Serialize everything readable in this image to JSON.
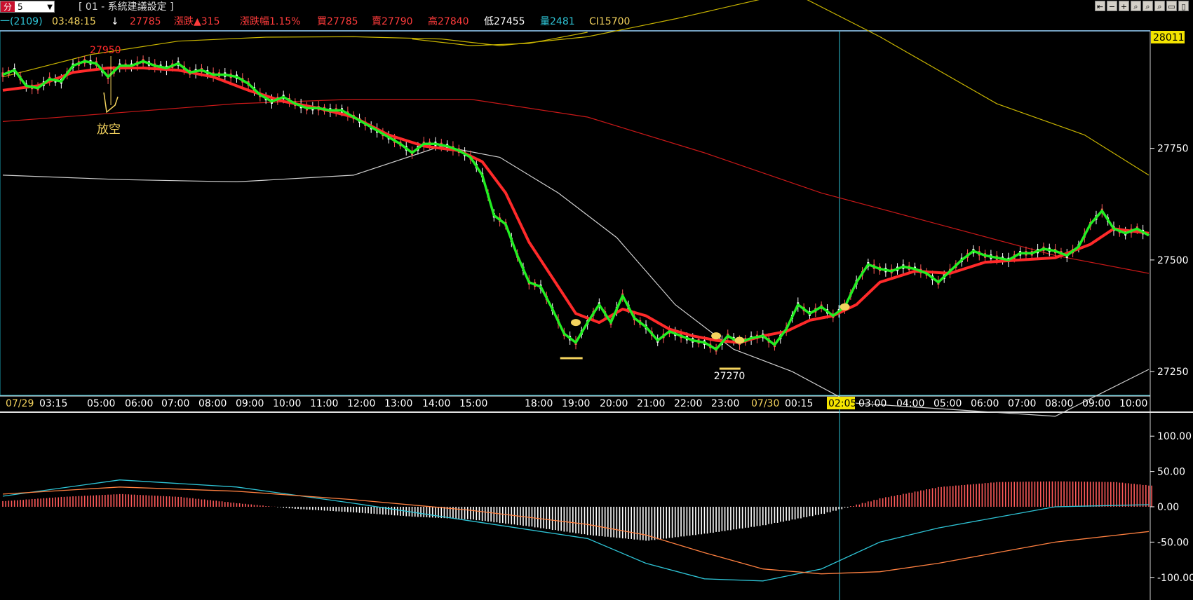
{
  "toolbar": {
    "period_prefix": "分",
    "period_value": "5",
    "title": "[ 01 - 系統建議設定 ]",
    "window_buttons": [
      "⇤",
      "−",
      "+",
      "⌕",
      "⌕",
      "⌕",
      "▭",
      "▯"
    ]
  },
  "quote": {
    "code": "一(2109)",
    "time": "03:48:15",
    "arrow": "↓",
    "price": "27785",
    "change": "漲跌▲315",
    "change_pct": "漲跌幅1.15%",
    "bid": "買27785",
    "ask": "賣27790",
    "high": "高27840",
    "low": "低27455",
    "volume": "量2481",
    "ci": "CI15700"
  },
  "colors": {
    "cyan": "#2ec4d6",
    "yellow": "#f4d35e",
    "red": "#ff2a2a",
    "green": "#22ee22",
    "white": "#ffffff",
    "grey": "#d0d0d0",
    "pink": "#ff5a5a",
    "orange": "#ff8040",
    "olive": "#c8b400"
  },
  "chart_data": [
    {
      "type": "line",
      "panel": "price",
      "y_axis_ticks": [
        27750,
        27500,
        27250
      ],
      "y_range": [
        27200,
        28010
      ],
      "top_price_label": "28011",
      "x_tick_labels": [
        "07/29 03:15",
        "05:00",
        "06:00",
        "07:00",
        "08:00",
        "09:00",
        "10:00",
        "11:00",
        "12:00",
        "13:00",
        "14:00",
        "15:00",
        "18:00",
        "19:00",
        "20:00",
        "21:00",
        "22:00",
        "23:00",
        "07/30 00:15",
        "02:05",
        "03:00",
        "04:00",
        "05:00",
        "06:00",
        "07:00",
        "08:00",
        "09:00",
        "10:00"
      ],
      "cursor_label": "02:05",
      "annotations": {
        "high_label": "27950",
        "low_label": "27270",
        "signal_text": "放空"
      },
      "series": {
        "green_fast": [
          [
            0,
            27915
          ],
          [
            2,
            27925
          ],
          [
            4,
            27890
          ],
          [
            6,
            27885
          ],
          [
            8,
            27905
          ],
          [
            10,
            27900
          ],
          [
            12,
            27935
          ],
          [
            14,
            27945
          ],
          [
            16,
            27940
          ],
          [
            18,
            27910
          ],
          [
            20,
            27935
          ],
          [
            22,
            27935
          ],
          [
            24,
            27945
          ],
          [
            26,
            27935
          ],
          [
            28,
            27930
          ],
          [
            30,
            27940
          ],
          [
            32,
            27920
          ],
          [
            34,
            27925
          ],
          [
            36,
            27915
          ],
          [
            38,
            27915
          ],
          [
            40,
            27910
          ],
          [
            42,
            27895
          ],
          [
            44,
            27870
          ],
          [
            46,
            27855
          ],
          [
            48,
            27865
          ],
          [
            50,
            27850
          ],
          [
            52,
            27840
          ],
          [
            54,
            27840
          ],
          [
            56,
            27835
          ],
          [
            58,
            27835
          ],
          [
            60,
            27820
          ],
          [
            62,
            27805
          ],
          [
            64,
            27790
          ],
          [
            66,
            27775
          ],
          [
            68,
            27760
          ],
          [
            70,
            27740
          ],
          [
            72,
            27760
          ],
          [
            74,
            27760
          ],
          [
            76,
            27755
          ],
          [
            78,
            27745
          ],
          [
            80,
            27730
          ],
          [
            82,
            27690
          ],
          [
            84,
            27600
          ],
          [
            86,
            27580
          ],
          [
            88,
            27510
          ],
          [
            90,
            27450
          ],
          [
            92,
            27440
          ],
          [
            94,
            27390
          ],
          [
            96,
            27335
          ],
          [
            98,
            27315
          ],
          [
            100,
            27360
          ],
          [
            102,
            27400
          ],
          [
            104,
            27360
          ],
          [
            106,
            27420
          ],
          [
            108,
            27370
          ],
          [
            110,
            27350
          ],
          [
            112,
            27320
          ],
          [
            114,
            27340
          ],
          [
            116,
            27330
          ],
          [
            118,
            27320
          ],
          [
            120,
            27315
          ],
          [
            122,
            27300
          ],
          [
            124,
            27330
          ],
          [
            126,
            27315
          ],
          [
            128,
            27325
          ],
          [
            130,
            27330
          ],
          [
            132,
            27310
          ],
          [
            134,
            27345
          ],
          [
            136,
            27400
          ],
          [
            138,
            27380
          ],
          [
            140,
            27395
          ],
          [
            142,
            27375
          ],
          [
            144,
            27395
          ],
          [
            146,
            27450
          ],
          [
            148,
            27490
          ],
          [
            150,
            27480
          ],
          [
            152,
            27475
          ],
          [
            154,
            27485
          ],
          [
            156,
            27480
          ],
          [
            158,
            27470
          ],
          [
            160,
            27450
          ],
          [
            162,
            27475
          ],
          [
            164,
            27500
          ],
          [
            166,
            27520
          ],
          [
            168,
            27510
          ],
          [
            170,
            27505
          ],
          [
            172,
            27500
          ],
          [
            174,
            27515
          ],
          [
            176,
            27515
          ],
          [
            178,
            27525
          ],
          [
            180,
            27520
          ],
          [
            182,
            27510
          ],
          [
            184,
            27530
          ],
          [
            186,
            27580
          ],
          [
            188,
            27610
          ],
          [
            190,
            27570
          ],
          [
            192,
            27560
          ],
          [
            194,
            27570
          ],
          [
            196,
            27555
          ]
        ],
        "red_ma": [
          [
            0,
            27880
          ],
          [
            6,
            27890
          ],
          [
            12,
            27920
          ],
          [
            18,
            27930
          ],
          [
            24,
            27930
          ],
          [
            30,
            27925
          ],
          [
            36,
            27910
          ],
          [
            42,
            27880
          ],
          [
            48,
            27855
          ],
          [
            54,
            27840
          ],
          [
            60,
            27820
          ],
          [
            66,
            27780
          ],
          [
            72,
            27755
          ],
          [
            78,
            27745
          ],
          [
            82,
            27720
          ],
          [
            86,
            27650
          ],
          [
            90,
            27540
          ],
          [
            94,
            27460
          ],
          [
            98,
            27380
          ],
          [
            102,
            27360
          ],
          [
            106,
            27390
          ],
          [
            110,
            27375
          ],
          [
            114,
            27345
          ],
          [
            118,
            27330
          ],
          [
            122,
            27320
          ],
          [
            126,
            27315
          ],
          [
            130,
            27330
          ],
          [
            134,
            27340
          ],
          [
            138,
            27365
          ],
          [
            142,
            27375
          ],
          [
            146,
            27400
          ],
          [
            150,
            27450
          ],
          [
            156,
            27475
          ],
          [
            162,
            27470
          ],
          [
            168,
            27495
          ],
          [
            174,
            27500
          ],
          [
            180,
            27505
          ],
          [
            186,
            27535
          ],
          [
            190,
            27570
          ],
          [
            196,
            27560
          ]
        ],
        "red_long": [
          [
            0,
            27810
          ],
          [
            20,
            27830
          ],
          [
            40,
            27850
          ],
          [
            60,
            27860
          ],
          [
            80,
            27860
          ],
          [
            100,
            27820
          ],
          [
            120,
            27740
          ],
          [
            140,
            27650
          ],
          [
            160,
            27580
          ],
          [
            180,
            27510
          ],
          [
            196,
            27470
          ]
        ],
        "white_ma": [
          [
            0,
            27690
          ],
          [
            20,
            27680
          ],
          [
            40,
            27675
          ],
          [
            60,
            27690
          ],
          [
            75,
            27755
          ],
          [
            85,
            27730
          ],
          [
            95,
            27650
          ],
          [
            105,
            27550
          ],
          [
            115,
            27400
          ],
          [
            125,
            27300
          ],
          [
            135,
            27250
          ],
          [
            145,
            27180
          ],
          [
            180,
            27150
          ],
          [
            196,
            27255
          ]
        ],
        "yellow_band_upper": [
          [
            0,
            27910
          ],
          [
            15,
            27960
          ],
          [
            30,
            27990
          ],
          [
            45,
            27999
          ],
          [
            60,
            28000
          ],
          [
            75,
            27995
          ],
          [
            85,
            27980
          ],
          [
            100,
            28000
          ],
          [
            115,
            28040
          ],
          [
            135,
            28100
          ],
          [
            150,
            28000
          ],
          [
            170,
            27850
          ],
          [
            185,
            27780
          ],
          [
            196,
            27690
          ]
        ],
        "yellow_band_top": [
          [
            70,
            27995
          ],
          [
            80,
            27980
          ],
          [
            90,
            27985
          ],
          [
            100,
            28010
          ]
        ]
      }
    },
    {
      "type": "bar",
      "panel": "macd",
      "y_axis_ticks": [
        100.0,
        50.0,
        0.0,
        -50.0,
        -100.0
      ],
      "y_tick_labels": [
        "100.00",
        "50.00",
        "0.00",
        "-50.00",
        "-100.00"
      ],
      "y_range": [
        -130,
        130
      ],
      "histogram": [
        [
          0,
          8
        ],
        [
          10,
          14
        ],
        [
          20,
          18
        ],
        [
          30,
          14
        ],
        [
          40,
          5
        ],
        [
          50,
          -3
        ],
        [
          60,
          -8
        ],
        [
          70,
          -14
        ],
        [
          80,
          -18
        ],
        [
          90,
          -28
        ],
        [
          100,
          -40
        ],
        [
          110,
          -48
        ],
        [
          120,
          -38
        ],
        [
          130,
          -26
        ],
        [
          140,
          -10
        ],
        [
          150,
          12
        ],
        [
          160,
          28
        ],
        [
          170,
          35
        ],
        [
          180,
          36
        ],
        [
          190,
          35
        ],
        [
          196,
          30
        ]
      ],
      "cyan_line": [
        [
          0,
          15
        ],
        [
          20,
          38
        ],
        [
          40,
          28
        ],
        [
          60,
          5
        ],
        [
          80,
          -20
        ],
        [
          100,
          -45
        ],
        [
          110,
          -80
        ],
        [
          120,
          -102
        ],
        [
          130,
          -105
        ],
        [
          140,
          -88
        ],
        [
          150,
          -50
        ],
        [
          160,
          -30
        ],
        [
          170,
          -15
        ],
        [
          180,
          0
        ],
        [
          196,
          3
        ]
      ],
      "orange_line": [
        [
          0,
          18
        ],
        [
          20,
          28
        ],
        [
          40,
          22
        ],
        [
          60,
          10
        ],
        [
          80,
          -5
        ],
        [
          100,
          -25
        ],
        [
          110,
          -40
        ],
        [
          120,
          -65
        ],
        [
          130,
          -88
        ],
        [
          140,
          -95
        ],
        [
          150,
          -92
        ],
        [
          160,
          -80
        ],
        [
          170,
          -65
        ],
        [
          180,
          -50
        ],
        [
          196,
          -35
        ]
      ]
    }
  ]
}
